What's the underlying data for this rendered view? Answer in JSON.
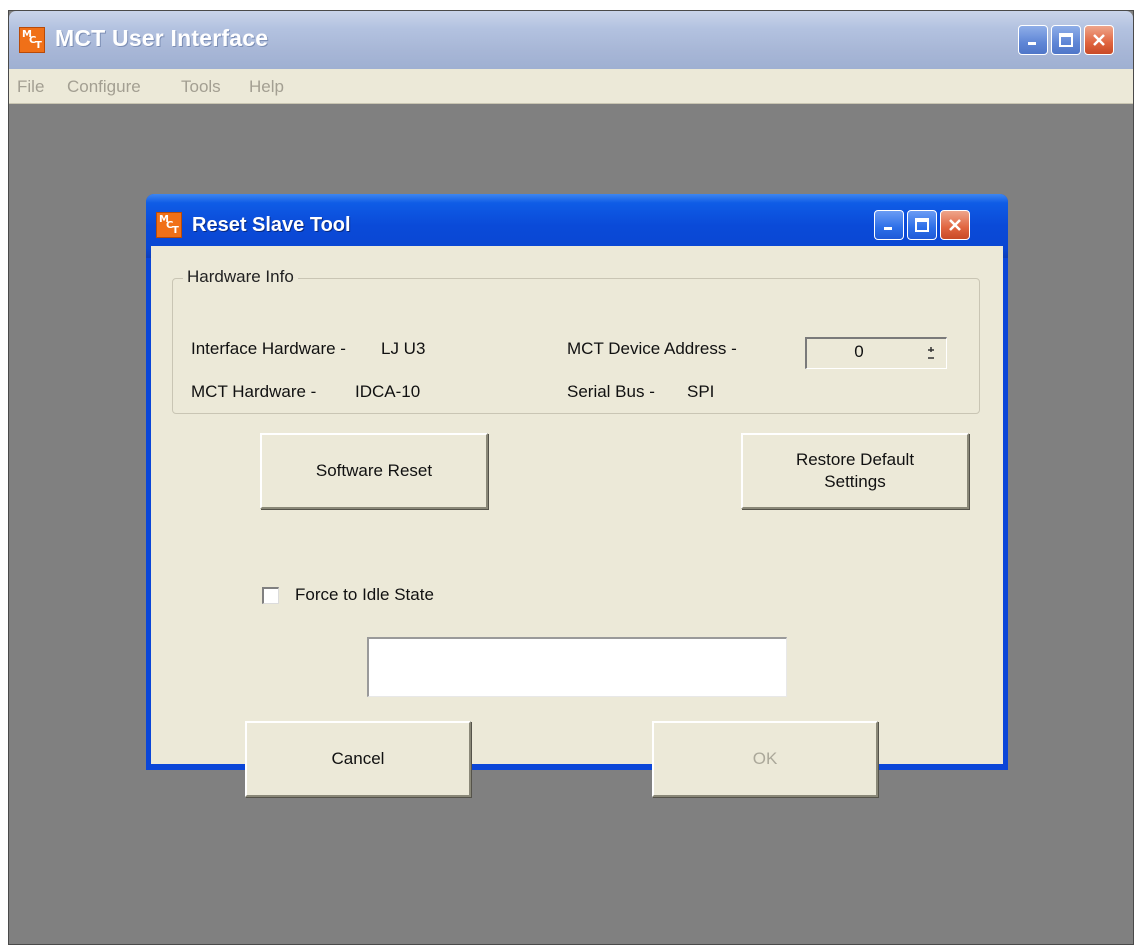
{
  "main_window": {
    "title": "MCT User Interface",
    "icon": "app-icon",
    "menu": [
      "File",
      "Configure",
      "Tools",
      "Help"
    ],
    "controls": [
      "minimize-icon",
      "maximize-icon",
      "close-icon"
    ]
  },
  "dialog": {
    "title": "Reset Slave Tool",
    "icon": "app-icon",
    "hardware_info": {
      "group_label": "Hardware Info",
      "interface_hardware_label": "Interface Hardware -",
      "interface_hardware_value": "LJ U3",
      "mct_hardware_label": "MCT Hardware -",
      "mct_hardware_value": "IDCA-10",
      "device_address_label": "MCT Device Address -",
      "device_address_value": "0",
      "serial_bus_label": "Serial Bus -",
      "serial_bus_value": "SPI"
    },
    "buttons": {
      "software_reset": "Software Reset",
      "restore_defaults_line1": "Restore Default",
      "restore_defaults_line2": "Settings",
      "cancel": "Cancel",
      "ok": "OK"
    },
    "force_idle": {
      "label": "Force to Idle State",
      "checked": false
    },
    "status_text": ""
  },
  "colors": {
    "dialog_titlebar": "#0a4ad8",
    "main_titlebar_inactive": "#a7b6d6",
    "workspace": "#808080",
    "control_face": "#ece9d8",
    "close_button": "#e0643f",
    "disabled_text": "#aba89a"
  }
}
